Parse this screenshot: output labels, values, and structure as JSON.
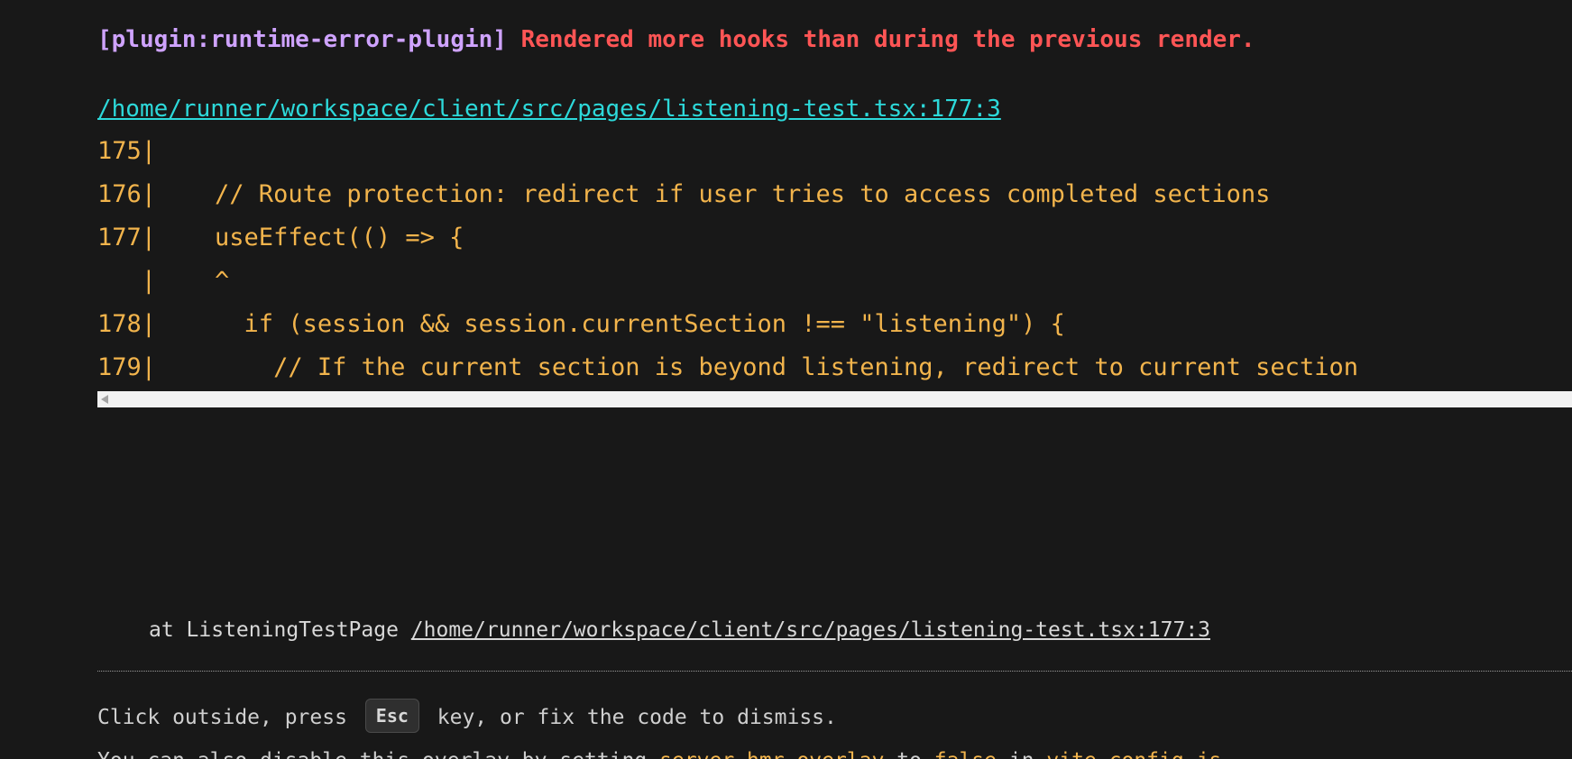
{
  "error": {
    "plugin": "[plugin:runtime-error-plugin]",
    "message": "Rendered more hooks than during the previous render."
  },
  "file": "/home/runner/workspace/client/src/pages/listening-test.tsx:177:3",
  "frame": {
    "lines": [
      "175|",
      "176|    // Route protection: redirect if user tries to access completed sections",
      "177|    useEffect(() => {",
      "   |    ^",
      "178|      if (session && session.currentSection !== \"listening\") {",
      "179|        // If the current section is beyond listening, redirect to current section"
    ]
  },
  "stack": {
    "prefix": "at ListeningTestPage ",
    "link": "/home/runner/workspace/client/src/pages/listening-test.tsx:177:3"
  },
  "tip": {
    "before": "Click outside, press ",
    "key": "Esc",
    "after": " key, or fix the code to dismiss.",
    "line2_start": "You can also disable this overlay by setting ",
    "line2_code1": "server.hmr.overlay",
    "line2_mid1": " to ",
    "line2_code2": "false",
    "line2_mid2": " in ",
    "line2_code3": "vite.config.js",
    "line2_end": "."
  },
  "colors": {
    "background": "#181818",
    "plugin": "#cfa3ff",
    "message": "#ff5555",
    "file_link": "#2dd9da",
    "code": "#f2b44c"
  }
}
